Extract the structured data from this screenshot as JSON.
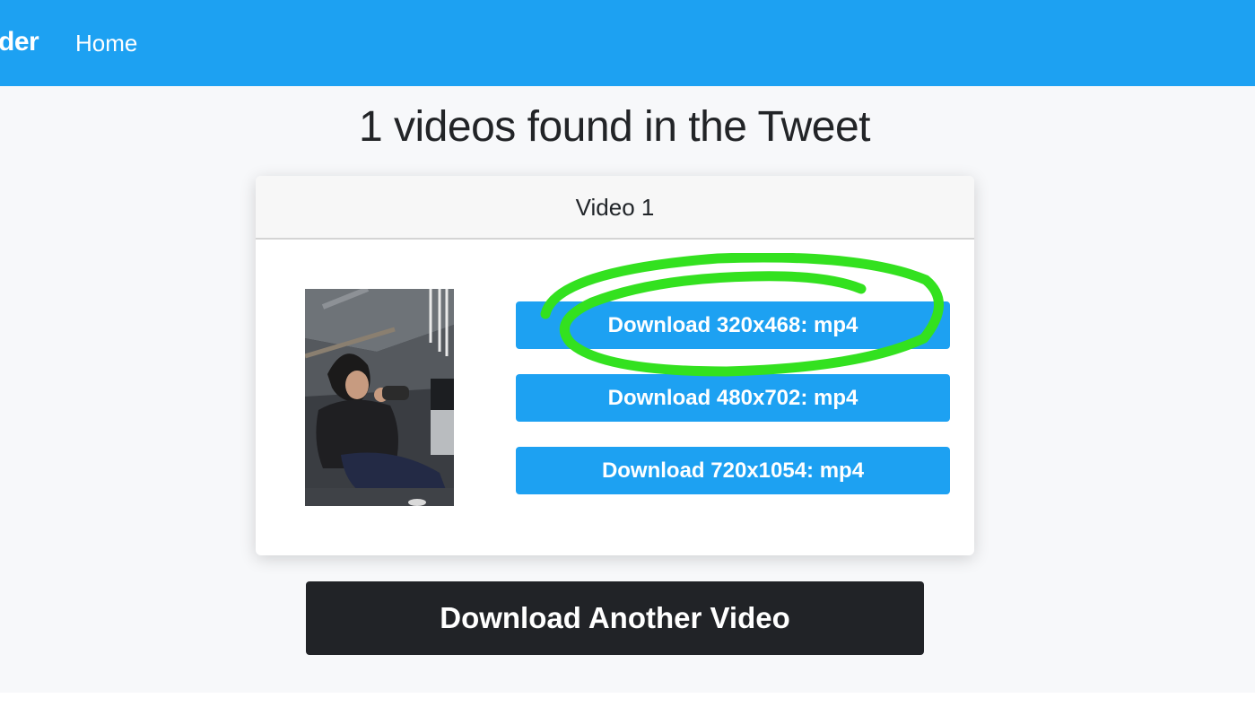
{
  "navbar": {
    "brand_label": "der",
    "home_label": "Home"
  },
  "main": {
    "title": "1 videos found in the Tweet",
    "video_card": {
      "header": "Video 1",
      "downloads": [
        {
          "label": "Download 320x468: mp4"
        },
        {
          "label": "Download 480x702: mp4"
        },
        {
          "label": "Download 720x1054: mp4"
        }
      ]
    },
    "another_button_label": "Download Another Video"
  },
  "colors": {
    "brand_blue": "#1da1f2",
    "dark_button": "#212327",
    "page_background": "#f7f8fa",
    "highlight_green": "#33e11f"
  }
}
